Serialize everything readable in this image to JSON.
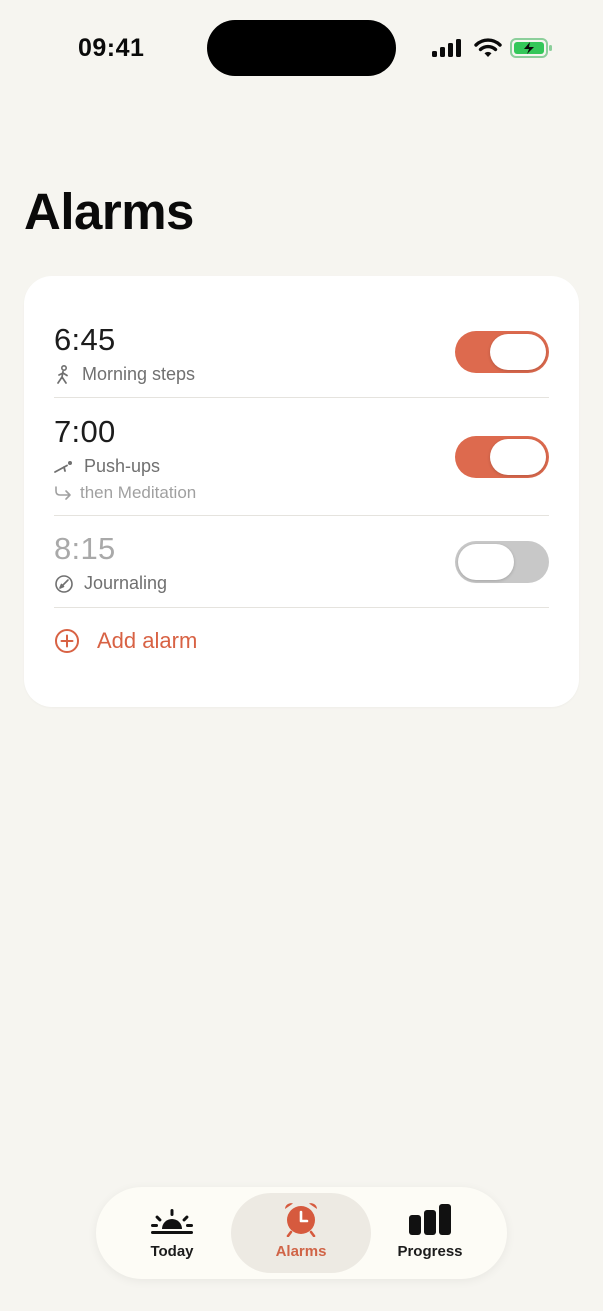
{
  "status_bar": {
    "time": "09:41"
  },
  "page": {
    "title": "Alarms"
  },
  "alarms": [
    {
      "time": "6:45",
      "habit": "Morning steps",
      "habit_icon": "walking-icon",
      "enabled": true
    },
    {
      "time": "7:00",
      "habit": "Push-ups",
      "habit_icon": "pushup-icon",
      "chain": "then Meditation",
      "chain_icon": "chain-arrow-icon",
      "enabled": true
    },
    {
      "time": "8:15",
      "habit": "Journaling",
      "habit_icon": "journal-icon",
      "enabled": false
    }
  ],
  "add_alarm": {
    "label": "Add alarm",
    "icon": "plus-circle-icon"
  },
  "tabs": [
    {
      "label": "Today",
      "icon": "sunrise-icon",
      "active": false
    },
    {
      "label": "Alarms",
      "icon": "alarm-clock-icon",
      "active": true
    },
    {
      "label": "Progress",
      "icon": "bar-chart-icon",
      "active": false
    }
  ],
  "colors": {
    "accent": "#dd6a4e",
    "background": "#f6f5f0",
    "card": "#ffffff",
    "toggle_off": "#c8c8c8",
    "battery": "#34c759"
  }
}
